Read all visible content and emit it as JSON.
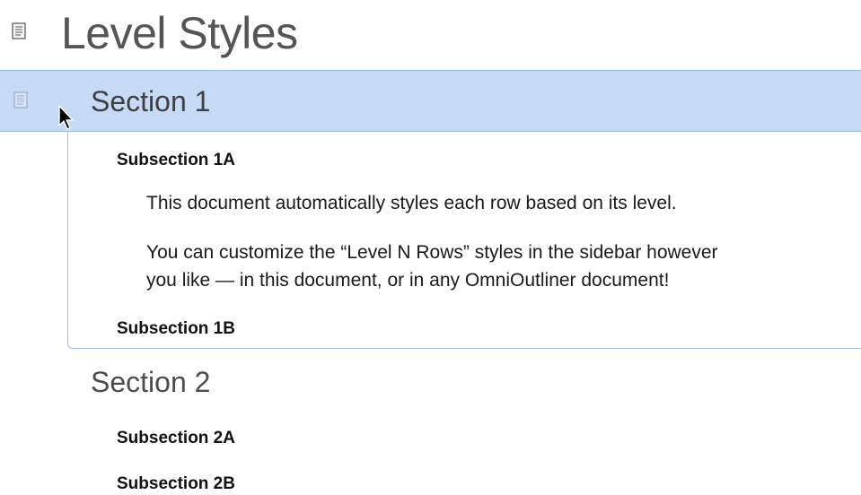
{
  "document": {
    "title": "Level Styles",
    "title_icon": "document-icon"
  },
  "outline": {
    "section_1": {
      "label": "Section 1",
      "selected": true,
      "subsection_1a": {
        "label": "Subsection 1A",
        "notes": [
          "This document automatically styles each row based on its level.",
          "You can customize the “Level N Rows” styles in the sidebar however",
          "you like — in this document, or in any OmniOutliner document!"
        ]
      },
      "subsection_1b": {
        "label": "Subsection 1B"
      }
    },
    "section_2": {
      "label": "Section 2",
      "subsection_2a": {
        "label": "Subsection 2A"
      },
      "subsection_2b": {
        "label": "Subsection 2B"
      }
    }
  },
  "colors": {
    "selection": "#c6d9f5",
    "selection_border": "#9bbbe8",
    "title": "#555555"
  }
}
